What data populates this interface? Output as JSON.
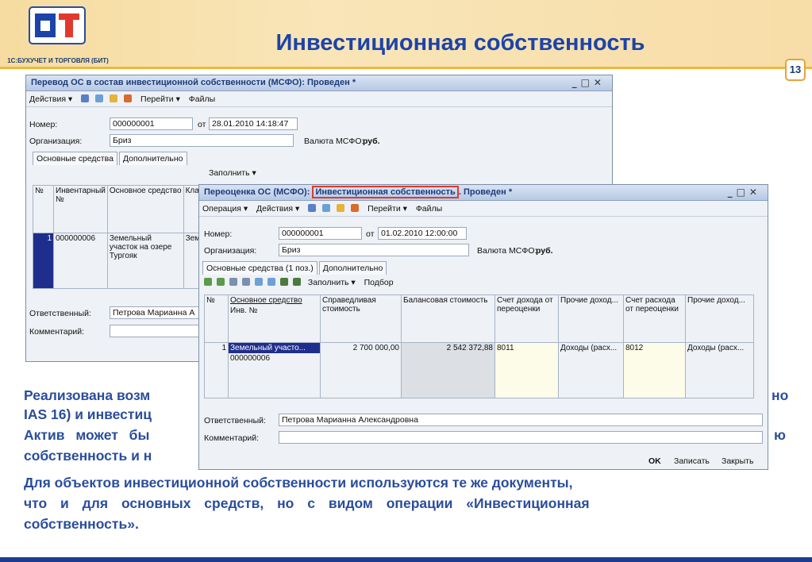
{
  "header": {
    "title": "Инвестиционная собственность",
    "logo_caption": "1С:БУХУЧЕТ И ТОРГОВЛЯ (БИТ)",
    "page_number": "13",
    "colors": {
      "title": "#1c44a8",
      "accent": "#f0b73e"
    }
  },
  "win1": {
    "title": "Перевод ОС в состав инвестиционной собственности (МСФО): Проведен *",
    "menu": [
      "Действия ▾",
      "Перейти ▾",
      "Файлы"
    ],
    "labels": {
      "number": "Номер:",
      "from": "от",
      "org": "Организация:",
      "currency": "Валюта МСФО:",
      "responsible": "Ответственный:",
      "comment": "Комментарий:"
    },
    "number": "000000001",
    "date": "28.01.2010 14:18:47",
    "org": "Бриз",
    "currency": "руб.",
    "tabs": [
      "Основные средства",
      "Дополнительно"
    ],
    "fill_btn": "Заполнить ▾",
    "headers": [
      "№",
      "Инвентарный №",
      "Основное средство",
      "Кла"
    ],
    "row": {
      "n": "1",
      "inv": "000000006",
      "asset": "Земельный участок на озере Тургояк",
      "cls": "Зем"
    },
    "responsible": "Петрова Марианна А"
  },
  "win2": {
    "title_a": "Переоценка ОС (МСФО): ",
    "title_b": "Инвестиционная собственность",
    "title_c": ". Проведен *",
    "menu": [
      "Операция ▾",
      "Действия ▾",
      "Перейти ▾",
      "Файлы"
    ],
    "labels": {
      "number": "Номер:",
      "from": "от",
      "org": "Организация:",
      "currency": "Валюта МСФО:",
      "responsible": "Ответственный:",
      "comment": "Комментарий:"
    },
    "number": "000000001",
    "date": "01.02.2010 12:00:00",
    "org": "Бриз",
    "currency": "руб.",
    "tabs": [
      "Основные средства (1 поз.)",
      "Дополнительно"
    ],
    "fill_btn": "Заполнить ▾",
    "pick_btn": "Подбор",
    "headers": {
      "n": "№",
      "asset": "Основное средство",
      "inv": "Инв. №",
      "fair": "Справедливая стоимость",
      "book": "Балансовая стоимость",
      "acc_inc": "Счет дохода от переоценки",
      "oth_inc": "Прочие доход...",
      "acc_exp": "Счет расхода от переоценки",
      "oth_exp": "Прочие доход..."
    },
    "row": {
      "n": "1",
      "asset": "Земельный участо...",
      "inv": "000000006",
      "fair": "2 700 000,00",
      "book": "2 542 372,88",
      "acc_inc": "8011",
      "oth_inc": "Доходы (расх...",
      "acc_exp": "8012",
      "oth_exp": "Доходы (расх..."
    },
    "responsible": "Петрова Марианна Александровна",
    "buttons": {
      "ok": "OK",
      "save": "Записать",
      "close": "Закрыть"
    }
  },
  "body": {
    "l1a": "Реализована возм",
    "l1b": "но",
    "l2a": "IAS 16) и инвестиц",
    "l3a": "Актив может бы",
    "l3b": "ю",
    "l4a": "собственность и н",
    "l5": "Для объектов инвестиционной собственности используются те же документы,",
    "l6": "что и для основных средств, но с видом операции «Инвестиционная",
    "l7": "собственность»."
  }
}
